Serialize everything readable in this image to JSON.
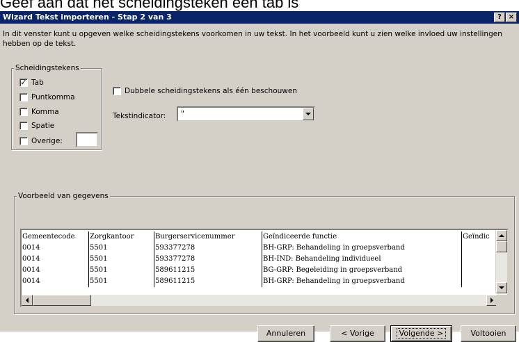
{
  "caption": "Geef aan dat het scheidingsteken een tab is",
  "window": {
    "title": "Wizard Tekst importeren - Stap 2 van 3",
    "help_label": "?",
    "close_label": "×"
  },
  "intro_text": "In dit venster kunt u opgeven welke scheidingstekens voorkomen in uw tekst. In het voorbeeld kunt u zien welke invloed uw instellingen hebben op de tekst.",
  "delimiters": {
    "group_label": "Scheidingstekens",
    "tab": {
      "label": "Tab",
      "checked": true
    },
    "semicolon": {
      "label": "Puntkomma",
      "checked": false
    },
    "comma": {
      "label": "Komma",
      "checked": false
    },
    "space": {
      "label": "Spatie",
      "checked": false
    },
    "other": {
      "label": "Overige:",
      "checked": false,
      "value": ""
    }
  },
  "consecutive": {
    "label": "Dubbele scheidingstekens als één beschouwen",
    "checked": false
  },
  "text_qualifier": {
    "label": "Tekstindicator:",
    "value": "\""
  },
  "preview": {
    "group_label": "Voorbeeld van gegevens",
    "columns": [
      "Gemeentecode",
      "Zorgkantoor",
      "Burgerservicenummer",
      "Geïndiceerde functie",
      "Geïndic"
    ],
    "rows": [
      [
        "0014",
        "5501",
        "593377278",
        "BH-GRP: Behandeling in groepsverband",
        ""
      ],
      [
        "0014",
        "5501",
        "593377278",
        "BH-IND: Behandeling individueel",
        ""
      ],
      [
        "0014",
        "5501",
        "589611215",
        "BG-GRP: Begeleiding in groepsverband",
        ""
      ],
      [
        "0014",
        "5501",
        "589611215",
        "BH-GRP: Behandeling in groepsverband",
        ""
      ]
    ]
  },
  "buttons": {
    "cancel": "Annuleren",
    "back": "< Vorige",
    "next": "Volgende >",
    "finish": "Voltooien"
  }
}
